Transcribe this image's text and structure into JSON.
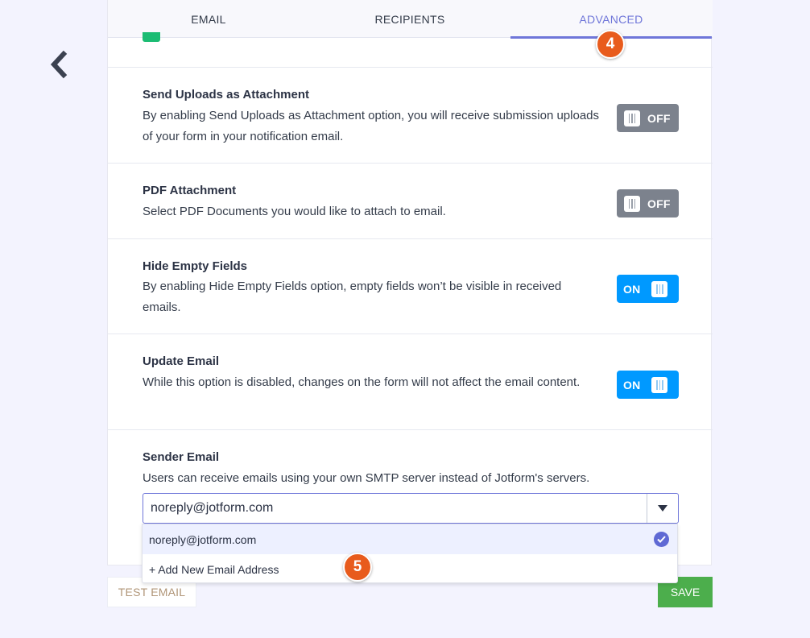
{
  "tabs": [
    {
      "label": "EMAIL"
    },
    {
      "label": "RECIPIENTS"
    },
    {
      "label": "ADVANCED"
    }
  ],
  "active_tab": "ADVANCED",
  "settings": [
    {
      "title": "Send Uploads as Attachment",
      "description": "By enabling Send Uploads as Attachment option, you will receive submission uploads of your form in your notification email.",
      "state": "OFF"
    },
    {
      "title": "PDF Attachment",
      "description": "Select PDF Documents you would like to attach to email.",
      "state": "OFF"
    },
    {
      "title": "Hide Empty Fields",
      "description": "By enabling Hide Empty Fields option, empty fields won’t be visible in received emails.",
      "state": "ON"
    },
    {
      "title": "Update Email",
      "description": "While this option is disabled, changes on the form will not affect the email content.",
      "state": "ON"
    }
  ],
  "sender": {
    "title": "Sender Email",
    "description": "Users can receive emails using your own SMTP server instead of Jotform's servers.",
    "selected_value": "noreply@jotform.com",
    "options": [
      {
        "label": "noreply@jotform.com",
        "selected": true
      },
      {
        "label": "+ Add New Email Address",
        "selected": false
      }
    ]
  },
  "badges": {
    "step4": "4",
    "step5": "5"
  },
  "buttons": {
    "test_email": "TEST EMAIL",
    "save": "SAVE"
  },
  "colors": {
    "accent": "#6f76d9",
    "toggle_on": "#0099ff",
    "toggle_off": "#7c828d",
    "save": "#4cae4c",
    "badge": "#e85b1c"
  },
  "icons": {
    "back": "chevron-left-icon",
    "dropdown": "caret-down-icon",
    "selected": "check-circle-icon"
  }
}
